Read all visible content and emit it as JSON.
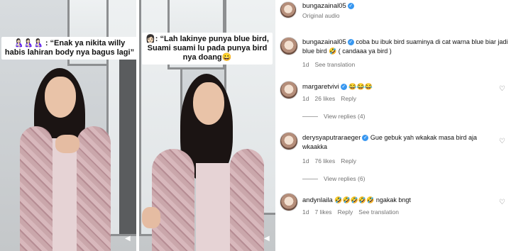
{
  "left_video": {
    "caption": "🤱🏻🤱🏻🤱🏻 : “Enak ya nikita willy habis lahiran body nya bagus lagi”"
  },
  "right_video": {
    "caption": "👩🏻: “Lah lakinye punya blue bird, Suami suami lu pada punya bird nya doang😀"
  },
  "post": {
    "username": "bungazainal05",
    "audio": "Original audio"
  },
  "comments": [
    {
      "username": "bungazainal05",
      "verified": true,
      "text": "coba bu ibuk bird suaminya di cat warna blue biar jadi blue bird 🤣 ( candaaa ya bird )",
      "time": "1d",
      "likes": "",
      "reply": "",
      "translate": "See translation",
      "view_replies": ""
    },
    {
      "username": "margaretvivi",
      "verified": true,
      "text": "😂😂😂",
      "time": "1d",
      "likes": "26 likes",
      "reply": "Reply",
      "translate": "",
      "view_replies": "View replies (4)"
    },
    {
      "username": "derysyaputraraeger",
      "verified": true,
      "text": "Gue gebuk yah wkakak masa bird aja wkaakka",
      "time": "1d",
      "likes": "76 likes",
      "reply": "Reply",
      "translate": "",
      "view_replies": "View replies (6)"
    },
    {
      "username": "andynlaila",
      "verified": false,
      "text": "🤣🤣🤣🤣🤣 ngakak bngt",
      "time": "1d",
      "likes": "7 likes",
      "reply": "Reply",
      "translate": "See translation",
      "view_replies": ""
    }
  ]
}
